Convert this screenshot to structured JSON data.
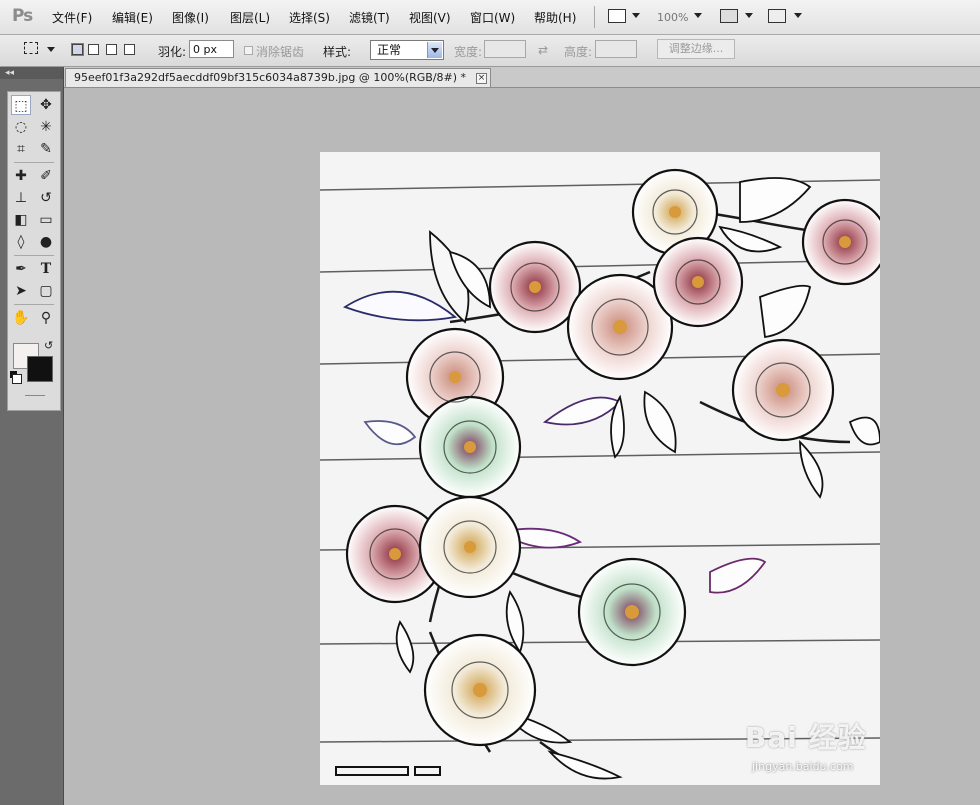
{
  "app": {
    "logo": "Ps"
  },
  "menu": [
    {
      "label": "文件(F)"
    },
    {
      "label": "编辑(E)"
    },
    {
      "label": "图像(I)"
    },
    {
      "label": "图层(L)"
    },
    {
      "label": "选择(S)"
    },
    {
      "label": "滤镜(T)"
    },
    {
      "label": "视图(V)"
    },
    {
      "label": "窗口(W)"
    },
    {
      "label": "帮助(H)"
    }
  ],
  "appbar": {
    "zoom": "100%"
  },
  "options": {
    "feather_label": "羽化:",
    "feather_value": "0 px",
    "antialias_label": "消除锯齿",
    "style_label": "样式:",
    "style_value": "正常",
    "width_label": "宽度:",
    "height_label": "高度:",
    "refine_edge_label": "调整边缘..."
  },
  "document": {
    "tab_title": "95eef01f3a292df5aecddf09bf315c6034a8739b.jpg @ 100%(RGB/8#) *",
    "close_glyph": "×"
  },
  "tools": [
    {
      "name": "marquee-tool",
      "glyph": "⬚"
    },
    {
      "name": "move-tool",
      "glyph": "✥"
    },
    {
      "name": "lasso-tool",
      "glyph": "◌"
    },
    {
      "name": "magic-wand-tool",
      "glyph": "✳"
    },
    {
      "name": "crop-tool",
      "glyph": "⌗"
    },
    {
      "name": "eyedropper-tool",
      "glyph": "✎"
    },
    {
      "name": "healing-brush-tool",
      "glyph": "✚"
    },
    {
      "name": "brush-tool",
      "glyph": "✐"
    },
    {
      "name": "clone-stamp-tool",
      "glyph": "⊥"
    },
    {
      "name": "history-brush-tool",
      "glyph": "↺"
    },
    {
      "name": "eraser-tool",
      "glyph": "◧"
    },
    {
      "name": "gradient-tool",
      "glyph": "▭"
    },
    {
      "name": "blur-tool",
      "glyph": "◊"
    },
    {
      "name": "dodge-tool",
      "glyph": "●"
    },
    {
      "name": "pen-tool",
      "glyph": "✒"
    },
    {
      "name": "type-tool",
      "glyph": "T"
    },
    {
      "name": "path-selection-tool",
      "glyph": "➤"
    },
    {
      "name": "shape-tool",
      "glyph": "▢"
    },
    {
      "name": "hand-tool",
      "glyph": "✋"
    },
    {
      "name": "zoom-tool",
      "glyph": "⚲"
    }
  ],
  "watermark": {
    "text": "Bai 经验",
    "sub": "jingyan.baidu.com"
  },
  "colors": {
    "foreground": "#111111",
    "background": "#f4f0ef"
  }
}
